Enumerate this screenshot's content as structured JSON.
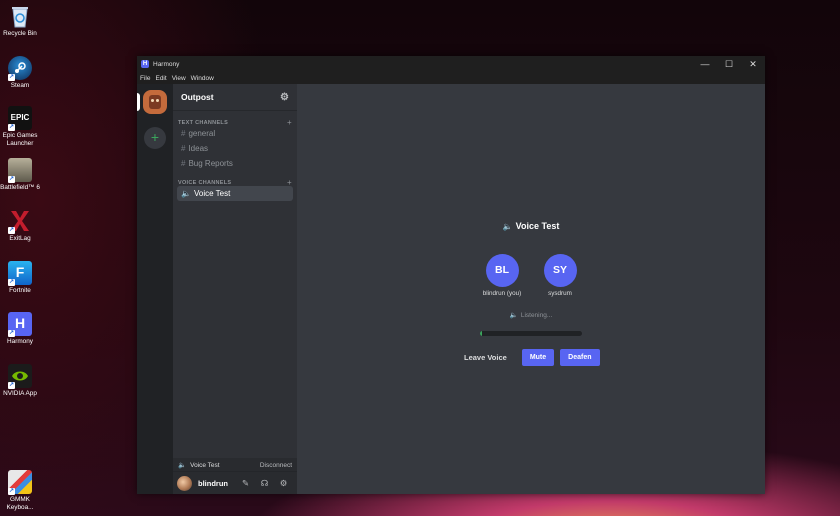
{
  "desktop": {
    "icons": [
      {
        "label": "Recycle Bin"
      },
      {
        "label": "Steam"
      },
      {
        "label": "Epic Games Launcher",
        "art": "EPIC"
      },
      {
        "label": "Battlefield™ 6"
      },
      {
        "label": "ExitLag"
      },
      {
        "label": "Fortnite",
        "art": "F"
      },
      {
        "label": "Harmony",
        "art": "H"
      },
      {
        "label": "NVIDIA App"
      },
      {
        "label": "GMMK Keyboa..."
      }
    ]
  },
  "window": {
    "title": "Harmony",
    "app_icon_letter": "H",
    "controls": [
      "—",
      "☐",
      "✕"
    ],
    "menu": [
      "File",
      "Edit",
      "View",
      "Window"
    ]
  },
  "servers": {
    "add_symbol": "+"
  },
  "guild": {
    "name": "Outpost",
    "text_category": "TEXT CHANNELS",
    "voice_category": "VOICE CHANNELS",
    "text_channels": [
      "general",
      "Ideas",
      "Bug Reports"
    ],
    "voice_channels": [
      "Voice Test"
    ],
    "hash": "#",
    "plus": "+"
  },
  "voice_status": {
    "channel": "Voice Test",
    "disconnect": "Disconnect"
  },
  "user": {
    "name": "blindrun"
  },
  "voice_view": {
    "title": "Voice Test",
    "participants": [
      {
        "initials": "BL",
        "name": "blindrun (you)"
      },
      {
        "initials": "SY",
        "name": "sysdrum"
      }
    ],
    "listening": "Listening...",
    "meter_level": 0.02,
    "leave_label": "Leave Voice",
    "mute_label": "Mute",
    "deafen_label": "Deafen"
  },
  "colors": {
    "accent": "#5865f2",
    "success": "#3ba55d"
  }
}
